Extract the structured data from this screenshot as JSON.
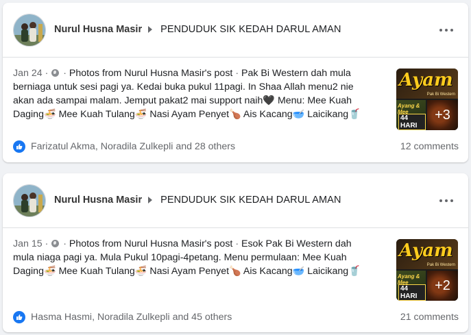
{
  "posts": [
    {
      "author": "Nurul Husna Masir",
      "group": "PENDUDUK SIK KEDAH DARUL AMAN",
      "date": "Jan 24",
      "source": "Photos from Nurul Husna Masir's post",
      "text": "Pak Bi Western dah mula berniaga untuk sesi pagi ya. Kedai buka pukul 11pagi. In Shaa Allah menu2 nie akan ada sampai malam. Jemput pakat2 mai support naih🖤 Menu: Mee Kuah Daging🍜 Mee Kuah Tulang🍜 Nasi Ayam Penyet🍗 Ais Kacang🥣 Laicikang🥤",
      "thumb_title": "Ayam",
      "thumb_tag": "Pak Bi Western",
      "thumb_sub": "Ayang & Mee",
      "thumb_badge": "44 HARI",
      "more_count": "+3",
      "reactions": "Farizatul Akma, Noradila Zulkepli and 28 others",
      "comments": "12 comments"
    },
    {
      "author": "Nurul Husna Masir",
      "group": "PENDUDUK SIK KEDAH DARUL AMAN",
      "date": "Jan 15",
      "source": "Photos from Nurul Husna Masir's post",
      "text": "Esok Pak Bi Western dah mula niaga pagi ya. Mula Pukul 10pagi-4petang. Menu permulaan: Mee Kuah Daging🍜 Mee Kuah Tulang🍜 Nasi Ayam Penyet🍗 Ais Kacang🥣 Laicikang🥤",
      "thumb_title": "Ayam",
      "thumb_tag": "Pak Bi Western",
      "thumb_sub": "Ayang & Mee",
      "thumb_badge": "44 HARI",
      "more_count": "+2",
      "reactions": "Hasma Hasmi, Noradila Zulkepli and 45 others",
      "comments": "21 comments"
    }
  ],
  "separator": "·",
  "icons": {
    "audience": "globe-icon",
    "menu": "more-options-icon",
    "reaction": "like-icon",
    "arrow": "caret-right-icon"
  },
  "colors": {
    "background": "#f0f2f5",
    "card": "#ffffff",
    "secondary_text": "#65676b",
    "like_blue": "#1877f2"
  }
}
